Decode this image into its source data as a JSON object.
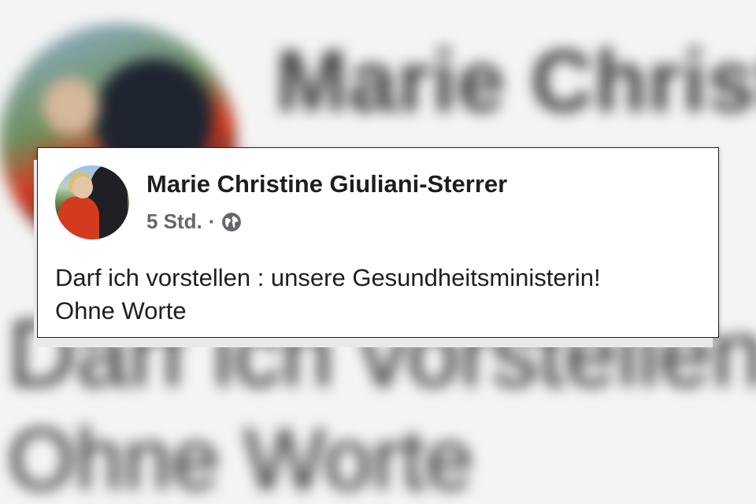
{
  "post": {
    "author": "Marie Christine Giuliani-Sterrer",
    "time": "5 Std.",
    "separator": "·",
    "privacy_icon": "globe-icon",
    "text_line1": "Darf ich vorstellen : unsere Gesundheitsministerin!",
    "text_line2": "Ohne Worte"
  },
  "background": {
    "name_fragment": "Marie Christ",
    "line1_fragment": "Darf ich vorstellen :",
    "line2_fragment": "Ohne Worte"
  },
  "colors": {
    "name_text": "#1c1e21",
    "meta_text": "#65676b"
  }
}
